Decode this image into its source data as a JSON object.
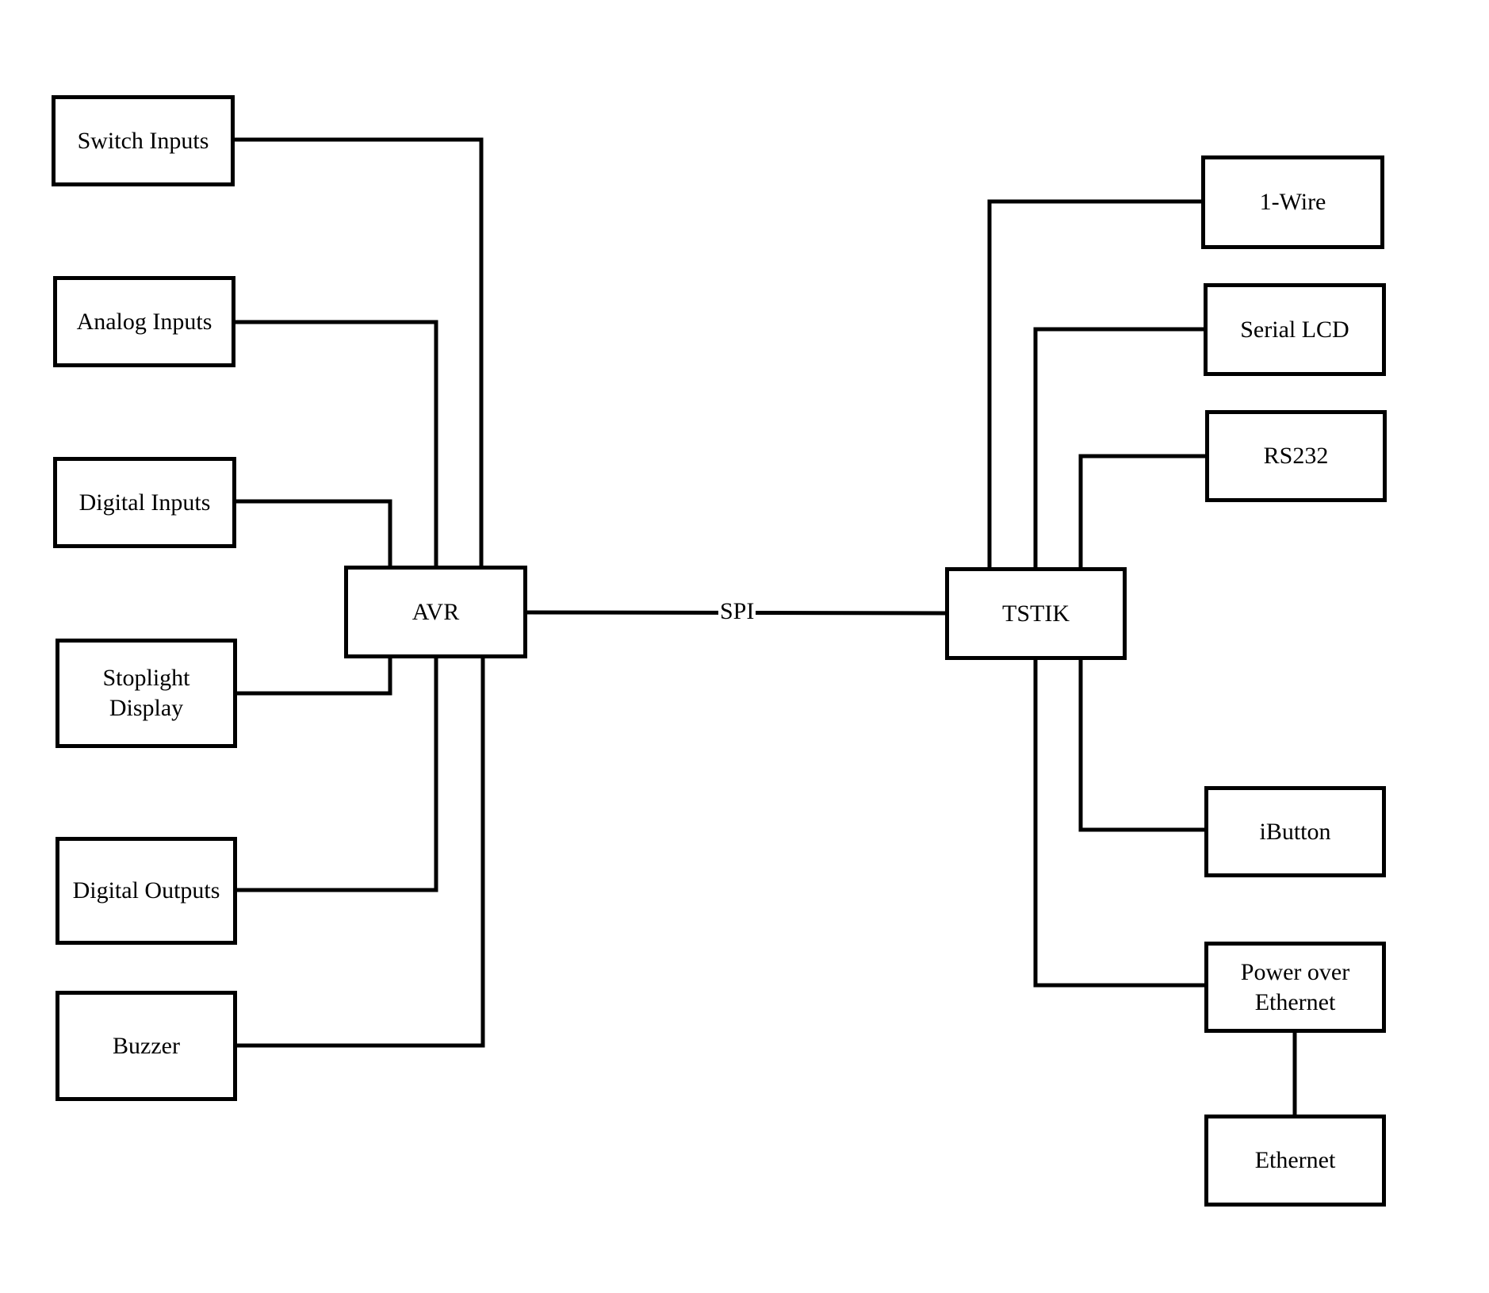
{
  "diagram": {
    "left_blocks": {
      "switch_inputs": "Switch Inputs",
      "analog_inputs": "Analog Inputs",
      "digital_inputs": "Digital Inputs",
      "stoplight_display": "Stoplight\nDisplay",
      "digital_outputs": "Digital Outputs",
      "buzzer": "Buzzer"
    },
    "center_blocks": {
      "avr": "AVR",
      "tstik": "TSTIK"
    },
    "link_label": "SPI",
    "right_blocks": {
      "one_wire": "1-Wire",
      "serial_lcd": "Serial LCD",
      "rs232": "RS232",
      "ibutton": "iButton",
      "poe": "Power over\nEthernet",
      "ethernet": "Ethernet"
    },
    "connections": [
      [
        "Switch Inputs",
        "AVR"
      ],
      [
        "Analog Inputs",
        "AVR"
      ],
      [
        "Digital Inputs",
        "AVR"
      ],
      [
        "Stoplight Display",
        "AVR"
      ],
      [
        "Digital Outputs",
        "AVR"
      ],
      [
        "Buzzer",
        "AVR"
      ],
      [
        "AVR",
        "TSTIK",
        "SPI"
      ],
      [
        "TSTIK",
        "1-Wire"
      ],
      [
        "TSTIK",
        "Serial LCD"
      ],
      [
        "TSTIK",
        "RS232"
      ],
      [
        "TSTIK",
        "iButton"
      ],
      [
        "TSTIK",
        "Power over Ethernet"
      ],
      [
        "Power over Ethernet",
        "Ethernet"
      ]
    ]
  }
}
